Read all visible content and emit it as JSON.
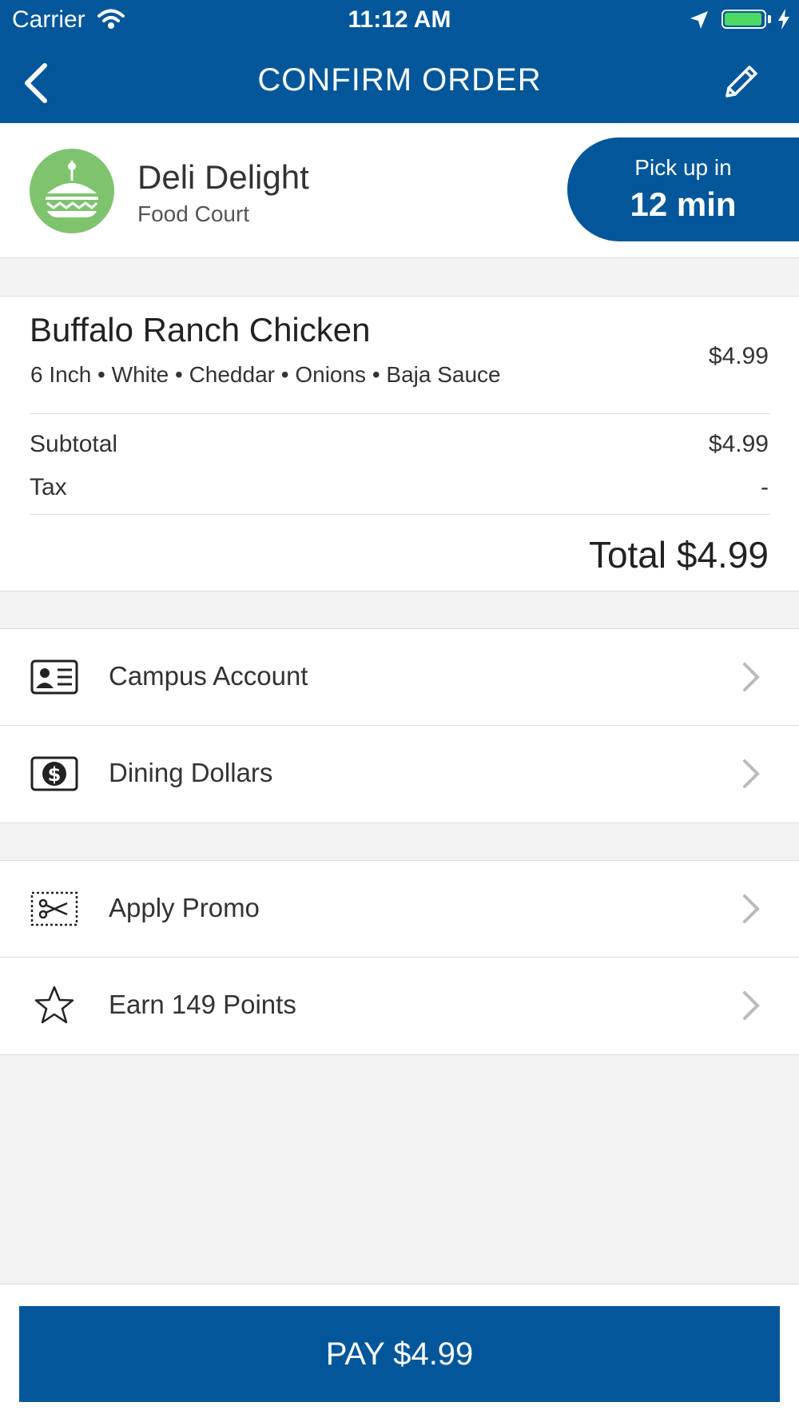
{
  "status_bar": {
    "carrier": "Carrier",
    "time": "11:12 AM"
  },
  "nav": {
    "title": "CONFIRM ORDER"
  },
  "store": {
    "name": "Deli Delight",
    "location": "Food Court",
    "pickup_label": "Pick up in",
    "pickup_time": "12 min",
    "logo_color": "#7ec46f"
  },
  "order": {
    "item_name": "Buffalo Ranch Chicken",
    "item_modifiers": "6 Inch • White • Cheddar • Onions • Baja Sauce",
    "item_price": "$4.99",
    "subtotal_label": "Subtotal",
    "subtotal_value": "$4.99",
    "tax_label": "Tax",
    "tax_value": "-",
    "total": "Total $4.99"
  },
  "payment_methods": [
    {
      "label": "Campus Account",
      "icon": "id-card-icon"
    },
    {
      "label": "Dining Dollars",
      "icon": "dollar-bill-icon"
    }
  ],
  "extras": [
    {
      "label": "Apply Promo",
      "icon": "coupon-icon"
    },
    {
      "label": "Earn 149 Points",
      "icon": "star-icon"
    }
  ],
  "pay_button": {
    "label": "PAY $4.99"
  },
  "colors": {
    "brand": "#02579b",
    "background": "#f3f3f3",
    "battery": "#4cd964"
  }
}
